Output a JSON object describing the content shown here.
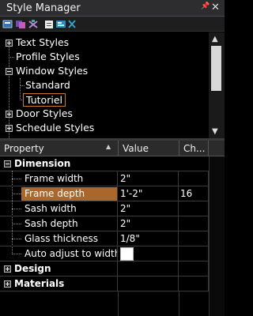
{
  "window": {
    "title": "Style Manager",
    "pin_glyph": "📌",
    "close_glyph": "✕"
  },
  "toolbar": {
    "buttons": [
      {
        "name": "new-style-icon"
      },
      {
        "name": "copy-style-icon"
      },
      {
        "name": "purge-style-icon"
      },
      {
        "name": "paste-style-icon"
      },
      {
        "name": "edit-style-icon"
      },
      {
        "name": "delete-style-icon"
      }
    ]
  },
  "tree": {
    "items": [
      {
        "label": "Text Styles",
        "expander": "plus"
      },
      {
        "label": "Profile Styles",
        "expander": "none"
      },
      {
        "label": "Window Styles",
        "expander": "minus"
      },
      {
        "label": "Standard",
        "expander": "none"
      },
      {
        "label": "Tutoriel",
        "expander": "none",
        "selected": true
      },
      {
        "label": "Door Styles",
        "expander": "plus"
      },
      {
        "label": "Schedule Styles",
        "expander": "plus"
      }
    ]
  },
  "grid": {
    "columns": {
      "property": "Property",
      "value": "Value",
      "ch": "Ch..."
    },
    "categories": {
      "dimension": "Dimension",
      "design": "Design",
      "materials": "Materials"
    },
    "rows": [
      {
        "property": "Frame width",
        "value": "2\"",
        "ch": ""
      },
      {
        "property": "Frame depth",
        "value": "1'-2\"",
        "ch": "16",
        "highlight": true
      },
      {
        "property": "Sash width",
        "value": "2\"",
        "ch": ""
      },
      {
        "property": "Sash depth",
        "value": "2\"",
        "ch": ""
      },
      {
        "property": "Glass thickness",
        "value": "1/8\"",
        "ch": ""
      },
      {
        "property": "Auto adjust to width ...",
        "value": "",
        "ch": "",
        "checkbox": true
      }
    ]
  },
  "colors": {
    "highlight": "#a9672b",
    "selected_border": "#c87a2f",
    "background": "#000000"
  }
}
